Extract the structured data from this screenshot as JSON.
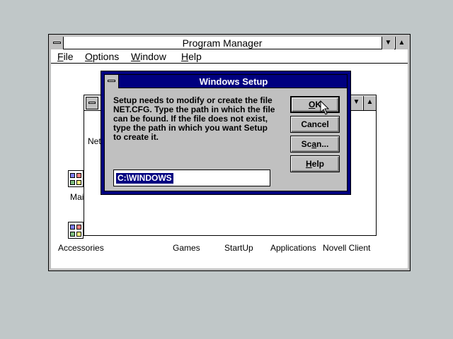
{
  "program_manager": {
    "title": "Program Manager",
    "minimize_glyph": "▼",
    "maximize_glyph": "▲",
    "menu": [
      {
        "pre": "",
        "u": "F",
        "post": "ile"
      },
      {
        "pre": "",
        "u": "O",
        "post": "ptions"
      },
      {
        "pre": "",
        "u": "W",
        "post": "indow"
      },
      {
        "pre": "",
        "u": "H",
        "post": "elp"
      }
    ]
  },
  "group_window": {
    "title_partial": "Net",
    "main_label_partial": "Mai"
  },
  "groups": [
    "Accessories",
    "Games",
    "StartUp",
    "Applications",
    "Novell Client"
  ],
  "dialog": {
    "title": "Windows Setup",
    "message": "Setup needs to modify or create the file NET.CFG. Type the path in which the file can be found. If the file does not exist, type the path in which you want Setup to create it.",
    "path_value": "C:\\WINDOWS",
    "buttons": {
      "ok": {
        "pre": "",
        "u": "O",
        "post": "K"
      },
      "cancel": {
        "label": "Cancel"
      },
      "scan": {
        "pre": "Sc",
        "u": "a",
        "post": "n..."
      },
      "help": {
        "pre": "",
        "u": "H",
        "post": "elp"
      }
    }
  },
  "colors": {
    "desktop": "#c0c7c8",
    "dialog_title": "#000080",
    "selection": "#000080"
  },
  "icons": [
    "system-menu-icon",
    "minimize-icon",
    "maximize-icon",
    "group-icon",
    "mouse-pointer-icon"
  ]
}
